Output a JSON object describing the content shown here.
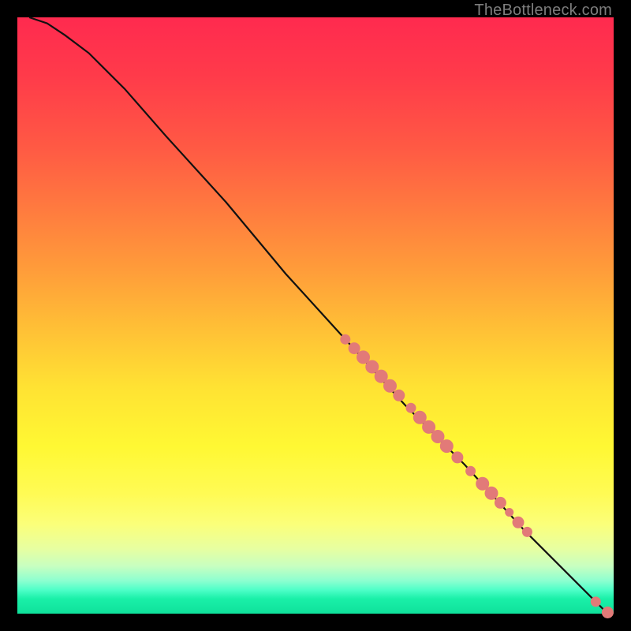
{
  "watermark": "TheBottleneck.com",
  "chart_data": {
    "type": "line",
    "title": "",
    "xlabel": "",
    "ylabel": "",
    "xlim": [
      0,
      100
    ],
    "ylim": [
      0,
      100
    ],
    "curve": [
      {
        "x": 2,
        "y": 100
      },
      {
        "x": 5,
        "y": 99
      },
      {
        "x": 8,
        "y": 97
      },
      {
        "x": 12,
        "y": 94
      },
      {
        "x": 18,
        "y": 88
      },
      {
        "x": 25,
        "y": 80
      },
      {
        "x": 35,
        "y": 69
      },
      {
        "x": 45,
        "y": 57
      },
      {
        "x": 55,
        "y": 46
      },
      {
        "x": 65,
        "y": 35
      },
      {
        "x": 75,
        "y": 25
      },
      {
        "x": 85,
        "y": 14
      },
      {
        "x": 95,
        "y": 4
      },
      {
        "x": 99,
        "y": 0
      }
    ],
    "points_color": "#e27a78",
    "points": [
      {
        "x": 55.0,
        "y": 46.0,
        "r": 6
      },
      {
        "x": 56.5,
        "y": 44.5,
        "r": 7
      },
      {
        "x": 58.0,
        "y": 43.0,
        "r": 8
      },
      {
        "x": 59.5,
        "y": 41.4,
        "r": 8
      },
      {
        "x": 61.0,
        "y": 39.8,
        "r": 8
      },
      {
        "x": 62.5,
        "y": 38.2,
        "r": 8
      },
      {
        "x": 64.0,
        "y": 36.6,
        "r": 7
      },
      {
        "x": 66.0,
        "y": 34.5,
        "r": 6
      },
      {
        "x": 67.5,
        "y": 32.9,
        "r": 8
      },
      {
        "x": 69.0,
        "y": 31.3,
        "r": 8
      },
      {
        "x": 70.5,
        "y": 29.7,
        "r": 8
      },
      {
        "x": 72.0,
        "y": 28.1,
        "r": 8
      },
      {
        "x": 73.8,
        "y": 26.2,
        "r": 7
      },
      {
        "x": 76.0,
        "y": 23.9,
        "r": 6
      },
      {
        "x": 78.0,
        "y": 21.8,
        "r": 8
      },
      {
        "x": 79.5,
        "y": 20.2,
        "r": 8
      },
      {
        "x": 81.0,
        "y": 18.6,
        "r": 7
      },
      {
        "x": 82.5,
        "y": 17.0,
        "r": 5
      },
      {
        "x": 84.0,
        "y": 15.3,
        "r": 7
      },
      {
        "x": 85.5,
        "y": 13.7,
        "r": 6
      },
      {
        "x": 97.0,
        "y": 2.0,
        "r": 6
      },
      {
        "x": 99.0,
        "y": 0.2,
        "r": 7
      }
    ]
  }
}
